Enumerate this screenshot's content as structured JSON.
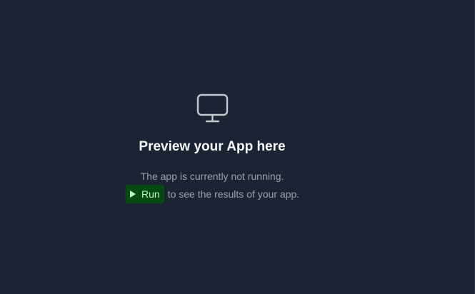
{
  "preview": {
    "icon": "monitor-icon",
    "title": "Preview your App here",
    "status_text": "The app is currently not running.",
    "run_button": {
      "icon": "play-icon",
      "label": "Run",
      "accent_bg": "#044a10",
      "accent_fg": "#bff7c2"
    },
    "hint_text": "to see the results of your app."
  }
}
